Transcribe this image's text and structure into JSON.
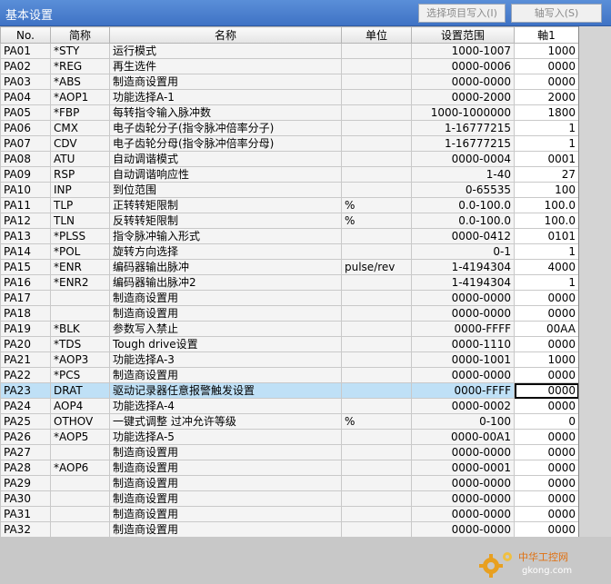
{
  "window": {
    "title": "基本设置",
    "write_selected": "选择项目写入(I)",
    "write_all": "轴写入(S)"
  },
  "columns": {
    "no": "No.",
    "abbr": "简称",
    "name": "名称",
    "unit": "单位",
    "range": "设置范围",
    "axis": "軸1"
  },
  "rows": [
    {
      "no": "PA01",
      "abbr": "*STY",
      "name": "运行模式",
      "unit": "",
      "range": "1000-1007",
      "value": "1000"
    },
    {
      "no": "PA02",
      "abbr": "*REG",
      "name": "再生选件",
      "unit": "",
      "range": "0000-0006",
      "value": "0000"
    },
    {
      "no": "PA03",
      "abbr": "*ABS",
      "name": "制造商设置用",
      "unit": "",
      "range": "0000-0000",
      "value": "0000"
    },
    {
      "no": "PA04",
      "abbr": "*AOP1",
      "name": "功能选择A-1",
      "unit": "",
      "range": "0000-2000",
      "value": "2000"
    },
    {
      "no": "PA05",
      "abbr": "*FBP",
      "name": "每转指令输入脉冲数",
      "unit": "",
      "range": "1000-1000000",
      "value": "1800"
    },
    {
      "no": "PA06",
      "abbr": "CMX",
      "name": "电子齿轮分子(指令脉冲倍率分子)",
      "unit": "",
      "range": "1-16777215",
      "value": "1"
    },
    {
      "no": "PA07",
      "abbr": "CDV",
      "name": "电子齿轮分母(指令脉冲倍率分母)",
      "unit": "",
      "range": "1-16777215",
      "value": "1"
    },
    {
      "no": "PA08",
      "abbr": "ATU",
      "name": "自动调谐模式",
      "unit": "",
      "range": "0000-0004",
      "value": "0001"
    },
    {
      "no": "PA09",
      "abbr": "RSP",
      "name": "自动调谐响应性",
      "unit": "",
      "range": "1-40",
      "value": "27"
    },
    {
      "no": "PA10",
      "abbr": "INP",
      "name": "到位范围",
      "unit": "",
      "range": "0-65535",
      "value": "100"
    },
    {
      "no": "PA11",
      "abbr": "TLP",
      "name": "正转转矩限制",
      "unit": "%",
      "range": "0.0-100.0",
      "value": "100.0"
    },
    {
      "no": "PA12",
      "abbr": "TLN",
      "name": "反转转矩限制",
      "unit": "%",
      "range": "0.0-100.0",
      "value": "100.0"
    },
    {
      "no": "PA13",
      "abbr": "*PLSS",
      "name": "指令脉冲输入形式",
      "unit": "",
      "range": "0000-0412",
      "value": "0101"
    },
    {
      "no": "PA14",
      "abbr": "*POL",
      "name": "旋转方向选择",
      "unit": "",
      "range": "0-1",
      "value": "1"
    },
    {
      "no": "PA15",
      "abbr": "*ENR",
      "name": "编码器输出脉冲",
      "unit": "pulse/rev",
      "range": "1-4194304",
      "value": "4000"
    },
    {
      "no": "PA16",
      "abbr": "*ENR2",
      "name": "编码器输出脉冲2",
      "unit": "",
      "range": "1-4194304",
      "value": "1"
    },
    {
      "no": "PA17",
      "abbr": "",
      "name": "制造商设置用",
      "unit": "",
      "range": "0000-0000",
      "value": "0000"
    },
    {
      "no": "PA18",
      "abbr": "",
      "name": "制造商设置用",
      "unit": "",
      "range": "0000-0000",
      "value": "0000"
    },
    {
      "no": "PA19",
      "abbr": "*BLK",
      "name": "参数写入禁止",
      "unit": "",
      "range": "0000-FFFF",
      "value": "00AA"
    },
    {
      "no": "PA20",
      "abbr": "*TDS",
      "name": "Tough drive设置",
      "unit": "",
      "range": "0000-1110",
      "value": "0000"
    },
    {
      "no": "PA21",
      "abbr": "*AOP3",
      "name": "功能选择A-3",
      "unit": "",
      "range": "0000-1001",
      "value": "1000"
    },
    {
      "no": "PA22",
      "abbr": "*PCS",
      "name": "制造商设置用",
      "unit": "",
      "range": "0000-0000",
      "value": "0000"
    },
    {
      "no": "PA23",
      "abbr": "DRAT",
      "name": "驱动记录器任意报警触发设置",
      "unit": "",
      "range": "0000-FFFF",
      "value": "0000",
      "selected": true
    },
    {
      "no": "PA24",
      "abbr": "AOP4",
      "name": "功能选择A-4",
      "unit": "",
      "range": "0000-0002",
      "value": "0000"
    },
    {
      "no": "PA25",
      "abbr": "OTHOV",
      "name": "一键式调整 过冲允许等级",
      "unit": "%",
      "range": "0-100",
      "value": "0"
    },
    {
      "no": "PA26",
      "abbr": "*AOP5",
      "name": "功能选择A-5",
      "unit": "",
      "range": "0000-00A1",
      "value": "0000"
    },
    {
      "no": "PA27",
      "abbr": "",
      "name": "制造商设置用",
      "unit": "",
      "range": "0000-0000",
      "value": "0000"
    },
    {
      "no": "PA28",
      "abbr": "*AOP6",
      "name": "制造商设置用",
      "unit": "",
      "range": "0000-0001",
      "value": "0000"
    },
    {
      "no": "PA29",
      "abbr": "",
      "name": "制造商设置用",
      "unit": "",
      "range": "0000-0000",
      "value": "0000"
    },
    {
      "no": "PA30",
      "abbr": "",
      "name": "制造商设置用",
      "unit": "",
      "range": "0000-0000",
      "value": "0000"
    },
    {
      "no": "PA31",
      "abbr": "",
      "name": "制造商设置用",
      "unit": "",
      "range": "0000-0000",
      "value": "0000"
    },
    {
      "no": "PA32",
      "abbr": "",
      "name": "制造商设置用",
      "unit": "",
      "range": "0000-0000",
      "value": "0000"
    }
  ],
  "watermark": {
    "brand": "中华工控网",
    "url": "gkong.com"
  },
  "colors": {
    "titlebar": "#4a80cf",
    "selected_row": "#bfe0f6"
  }
}
